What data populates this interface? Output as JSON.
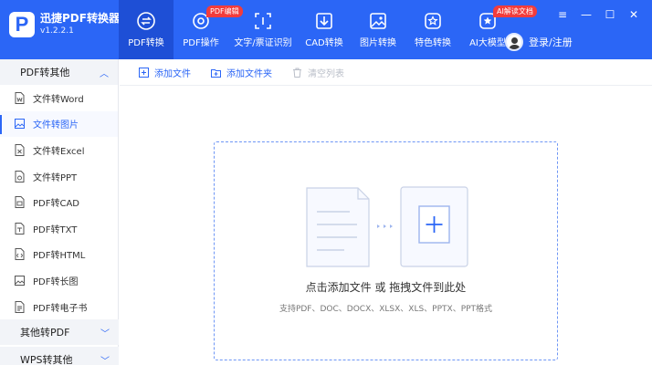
{
  "app": {
    "name": "迅捷PDF转换器",
    "version": "v1.2.2.1",
    "logo_letter": "P",
    "accent": "#2b66f6"
  },
  "topnav": [
    {
      "label": "PDF转换",
      "icon": "pdf-convert-icon",
      "active": true
    },
    {
      "label": "PDF操作",
      "icon": "pdf-operate-icon",
      "badge": "PDF编辑"
    },
    {
      "label": "文字/票证识别",
      "icon": "ocr-scan-icon"
    },
    {
      "label": "CAD转换",
      "icon": "cad-icon"
    },
    {
      "label": "图片转换",
      "icon": "image-icon"
    },
    {
      "label": "特色转换",
      "icon": "star-icon"
    },
    {
      "label": "AI大模型",
      "icon": "ai-icon",
      "badge": "AI解读文档"
    }
  ],
  "user": {
    "label": "登录/注册"
  },
  "window_controls": {
    "menu": "≡",
    "minimize": "—",
    "maximize": "☐",
    "close": "✕"
  },
  "sidebar": {
    "group1": {
      "label": "PDF转其他",
      "chevron": "︿"
    },
    "items": [
      {
        "label": "文件转Word"
      },
      {
        "label": "文件转图片",
        "active": true
      },
      {
        "label": "文件转Excel"
      },
      {
        "label": "文件转PPT"
      },
      {
        "label": "PDF转CAD"
      },
      {
        "label": "PDF转TXT"
      },
      {
        "label": "PDF转HTML"
      },
      {
        "label": "PDF转长图"
      },
      {
        "label": "PDF转电子书"
      }
    ],
    "group2": {
      "label": "其他转PDF",
      "chevron": "﹀"
    },
    "group3": {
      "label": "WPS转其他",
      "chevron": "﹀"
    }
  },
  "toolbar": {
    "add_file": "添加文件",
    "add_folder": "添加文件夹",
    "clear_list": "清空列表"
  },
  "dropzone": {
    "title": "点击添加文件 或 拖拽文件到此处",
    "subtitle": "支持PDF、DOC、DOCX、XLSX、XLS、PPTX、PPT格式"
  }
}
